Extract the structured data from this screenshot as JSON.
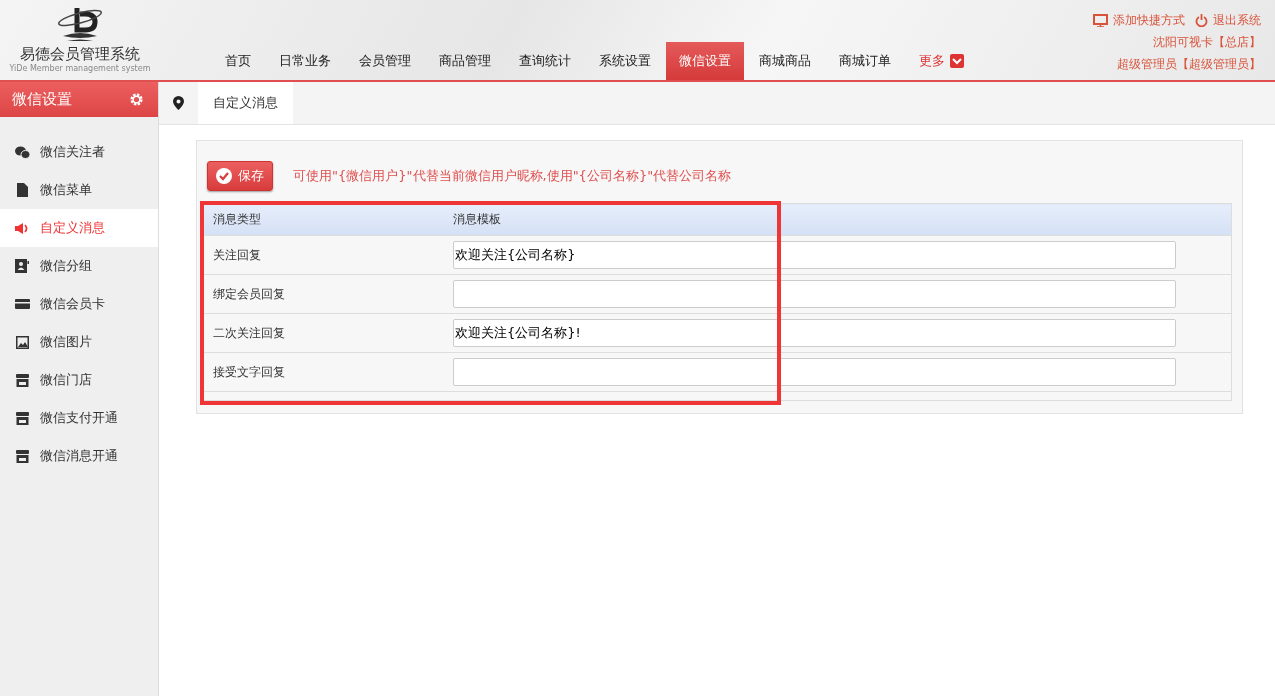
{
  "header": {
    "logo_title": "易德会员管理系统",
    "logo_subtitle": "YiDe Member management system",
    "nav": [
      {
        "label": "首页",
        "selected": false,
        "kind": "link"
      },
      {
        "label": "日常业务",
        "selected": false,
        "kind": "link"
      },
      {
        "label": "会员管理",
        "selected": false,
        "kind": "link"
      },
      {
        "label": "商品管理",
        "selected": false,
        "kind": "link"
      },
      {
        "label": "查询统计",
        "selected": false,
        "kind": "link"
      },
      {
        "label": "系统设置",
        "selected": false,
        "kind": "link"
      },
      {
        "label": "微信设置",
        "selected": true,
        "kind": "link"
      },
      {
        "label": "商城商品",
        "selected": false,
        "kind": "link"
      },
      {
        "label": "商城订单",
        "selected": false,
        "kind": "link"
      },
      {
        "label": "更多",
        "selected": false,
        "kind": "dropdown"
      }
    ],
    "actions": [
      {
        "label": "添加快捷方式",
        "kind": "shortcut"
      },
      {
        "label": "退出系统",
        "kind": "power"
      }
    ],
    "store": "沈阳可视卡【总店】",
    "user": "超级管理员【超级管理员】"
  },
  "sidebar": {
    "title": "微信设置",
    "items": [
      {
        "label": "微信关注者",
        "selected": false,
        "kind": "chat"
      },
      {
        "label": "微信菜单",
        "selected": false,
        "kind": "file"
      },
      {
        "label": "自定义消息",
        "selected": true,
        "kind": "speaker"
      },
      {
        "label": "微信分组",
        "selected": false,
        "kind": "contacts"
      },
      {
        "label": "微信会员卡",
        "selected": false,
        "kind": "card"
      },
      {
        "label": "微信图片",
        "selected": false,
        "kind": "image"
      },
      {
        "label": "微信门店",
        "selected": false,
        "kind": "store"
      },
      {
        "label": "微信支付开通",
        "selected": false,
        "kind": "store"
      },
      {
        "label": "微信消息开通",
        "selected": false,
        "kind": "store"
      }
    ]
  },
  "tabs": [
    {
      "label": "自定义消息",
      "selected": true
    }
  ],
  "save_button": "保存",
  "hint": "可使用\"{微信用户}\"代替当前微信用户昵称,使用\"{公司名称}\"代替公司名称",
  "table": {
    "columns": [
      "消息类型",
      "消息模板"
    ],
    "rows": [
      {
        "type": "关注回复",
        "template": "欢迎关注{公司名称}"
      },
      {
        "type": "绑定会员回复",
        "template": ""
      },
      {
        "type": "二次关注回复",
        "template": "欢迎关注{公司名称}!"
      },
      {
        "type": "接受文字回复",
        "template": ""
      }
    ]
  },
  "highlight_frame": true
}
